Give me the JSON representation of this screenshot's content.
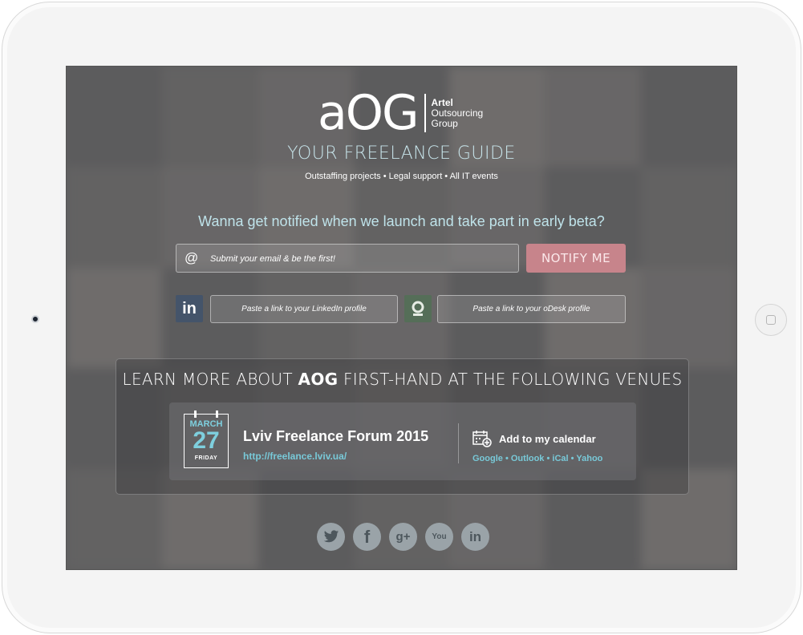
{
  "logo": {
    "mark": "aOG",
    "line1": "Artel",
    "line2": "Outsourcing",
    "line3": "Group"
  },
  "tagline": "YOUR FREELANCE GUIDE",
  "subtag": "Outstaffing projects • Legal support • All IT events",
  "question": "Wanna get notified when we launch and take part in early beta?",
  "signup": {
    "at_symbol": "@",
    "email_placeholder": "Submit your email & be the first!",
    "notify_label": "NOTIFY ME",
    "linkedin_icon_text": "in",
    "linkedin_placeholder": "Paste a link to your LinkedIn profile",
    "odesk_placeholder": "Paste a link to your oDesk profile"
  },
  "venues": {
    "title_pre": "LEARN MORE ABOUT ",
    "title_brand": "AOG",
    "title_post": " FIRST-HAND AT THE FOLLOWING VENUES",
    "event": {
      "month": "MARCH",
      "day": "27",
      "weekday": "FRIDAY",
      "name": "Lviv Freelance Forum 2015",
      "url": "http://freelance.lviv.ua/",
      "add_calendar": "Add to my calendar",
      "calendars": [
        "Google",
        "Outlook",
        "iCal",
        "Yahoo"
      ],
      "separator": "•"
    }
  },
  "social": [
    {
      "name": "twitter-icon",
      "glyph": "🐦"
    },
    {
      "name": "facebook-icon",
      "glyph": "f"
    },
    {
      "name": "google-plus-icon",
      "glyph": "g+"
    },
    {
      "name": "youtube-icon",
      "glyph": "You"
    },
    {
      "name": "linkedin-icon",
      "glyph": "in"
    }
  ],
  "colors": {
    "accent_cyan": "#78c9d8",
    "notify_button": "#c7848b",
    "linkedin": "#44546a",
    "odesk": "#556e58"
  }
}
